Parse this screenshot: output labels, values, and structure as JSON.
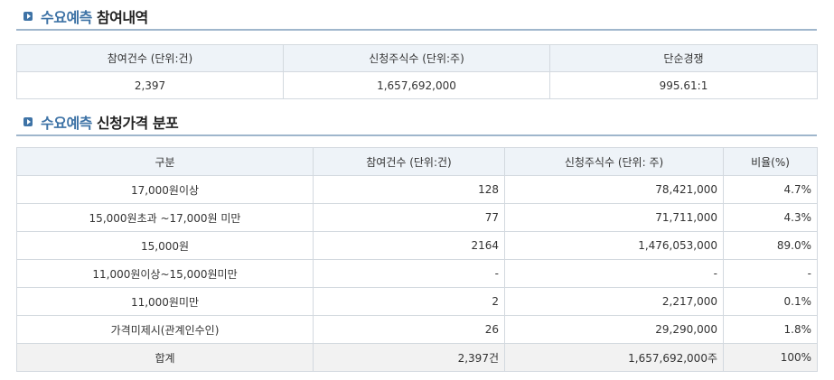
{
  "section1": {
    "accent": "수요예측",
    "title": "참여내역",
    "headers": [
      "참여건수 (단위:건)",
      "신청주식수 (단위:주)",
      "단순경쟁"
    ],
    "row": [
      "2,397",
      "1,657,692,000",
      "995.61:1"
    ]
  },
  "section2": {
    "accent": "수요예측",
    "title": "신청가격 분포",
    "headers": [
      "구분",
      "참여건수 (단위:건)",
      "신청주식수 (단위: 주)",
      "비율(%)"
    ],
    "rows": [
      [
        "17,000원이상",
        "128",
        "78,421,000",
        "4.7%"
      ],
      [
        "15,000원초과 ~17,000원 미만",
        "77",
        "71,711,000",
        "4.3%"
      ],
      [
        "15,000원",
        "2164",
        "1,476,053,000",
        "89.0%"
      ],
      [
        "11,000원이상~15,000원미만",
        "-",
        "-",
        "-"
      ],
      [
        "11,000원미만",
        "2",
        "2,217,000",
        "0.1%"
      ],
      [
        "가격미제시(관계인수인)",
        "26",
        "29,290,000",
        "1.8%"
      ]
    ],
    "total": [
      "합계",
      "2,397건",
      "1,657,692,000주",
      "100%"
    ]
  },
  "colors": {
    "accent": "#3e73a6",
    "header_bg": "#eef3f8",
    "total_bg": "#f2f2f2",
    "border": "#d3d9df"
  }
}
